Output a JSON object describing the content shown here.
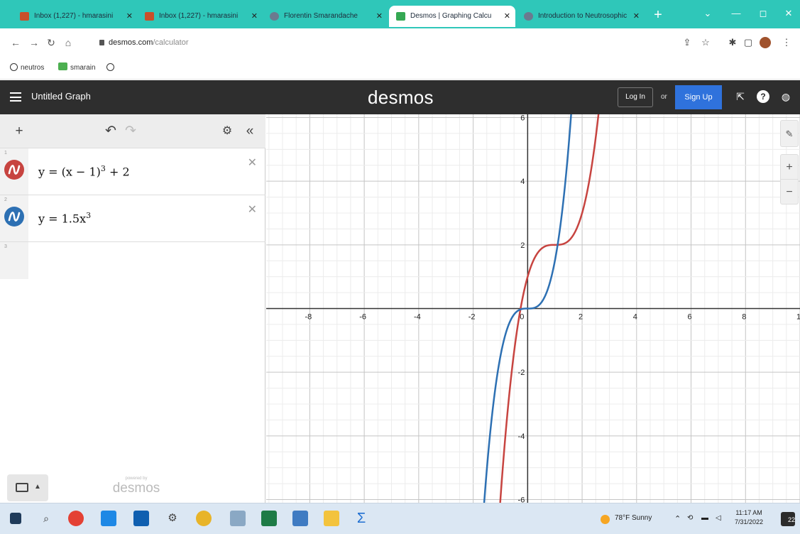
{
  "browser": {
    "tabs": [
      {
        "label": "Inbox (1,227) - hmarasini",
        "favicon_color": "#c8502a",
        "active": false
      },
      {
        "label": "Inbox (1,227) - hmarasini",
        "favicon_color": "#c8502a",
        "active": false
      },
      {
        "label": "Florentin Smarandache",
        "favicon_color": "#6b7a8f",
        "active": false
      },
      {
        "label": "Desmos | Graphing Calcu",
        "favicon_color": "#35a853",
        "active": true
      },
      {
        "label": "Introduction to Neutrosophic",
        "favicon_color": "#6b7a8f",
        "active": false
      }
    ],
    "new_tab": "+",
    "window_controls": {
      "chevron": "⌄",
      "minimize": "—",
      "maximize": "◻",
      "close": "✕"
    },
    "url_domain": "desmos.com",
    "url_path": "/calculator",
    "bookmarks": [
      {
        "label": "neutros",
        "icon": "globe-icon"
      },
      {
        "label": "smarain",
        "icon": "green-square-icon"
      },
      {
        "label": "",
        "icon": "globe-icon"
      }
    ]
  },
  "desmos": {
    "graph_title": "Untitled Graph",
    "logo": "desmos",
    "login_label": "Log In",
    "or_label": "or",
    "signup_label": "Sign Up",
    "expressions": [
      {
        "index": "1",
        "latex_base": "y = (x − 1)",
        "latex_exp": "3",
        "latex_tail": " + 2",
        "color": "#c74440"
      },
      {
        "index": "2",
        "latex_base": "y = 1.5x",
        "latex_exp": "3",
        "latex_tail": "",
        "color": "#2d70b3"
      },
      {
        "index": "3"
      }
    ],
    "powered_by": "powered by",
    "powered_logo": "desmos"
  },
  "chart_data": {
    "type": "line",
    "series": [
      {
        "formula": "y=(x-1)^3+2",
        "color": "#c74440"
      },
      {
        "formula": "y=1.5x^3",
        "color": "#2d70b3"
      }
    ],
    "xlim": [
      -9.6,
      10
    ],
    "ylim": [
      -6.1,
      6.1
    ],
    "x_tick_labels": [
      "-8",
      "-6",
      "-4",
      "-2",
      "0",
      "2",
      "4",
      "6",
      "8",
      "1"
    ],
    "y_tick_labels": [
      "6",
      "4",
      "2",
      "-2",
      "-4",
      "-6"
    ],
    "grid": true
  },
  "taskbar": {
    "weather": "78°F  Sunny",
    "time": "11:17 AM",
    "date": "7/31/2022",
    "notifications": "22"
  }
}
